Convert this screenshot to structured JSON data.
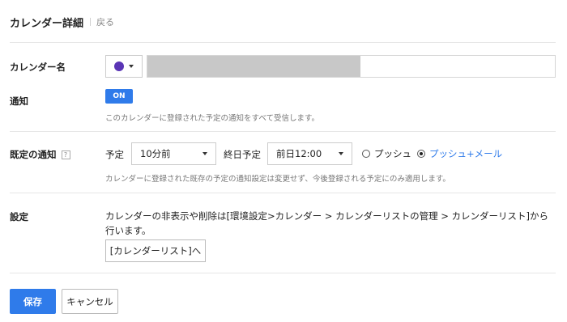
{
  "header": {
    "title": "カレンダー詳細",
    "back_label": "戻る"
  },
  "calendar_name": {
    "label": "カレンダー名",
    "color": "#5a35b5",
    "value": ""
  },
  "notification": {
    "label": "通知",
    "toggle_label": "ON",
    "hint": "このカレンダーに登録された予定の通知をすべて受信します。"
  },
  "default_notification": {
    "label": "既定の通知",
    "help_label": "?",
    "event_label": "予定",
    "event_value": "10分前",
    "allday_label": "終日予定",
    "allday_value": "前日12:00",
    "options": [
      {
        "label": "プッシュ",
        "checked": false
      },
      {
        "label": "プッシュ+メール",
        "checked": true
      }
    ],
    "hint": "カレンダーに登録された既存の予定の通知設定は変更せず、今後登録される予定にのみ適用します。"
  },
  "settings": {
    "label": "設定",
    "text": "カレンダーの非表示や削除は[環境設定>カレンダー > カレンダーリストの管理 > カレンダーリスト]から行います。",
    "link_button": "[カレンダーリスト]へ"
  },
  "footer": {
    "save_label": "保存",
    "cancel_label": "キャンセル"
  },
  "colors": {
    "accent": "#2f7bea"
  }
}
